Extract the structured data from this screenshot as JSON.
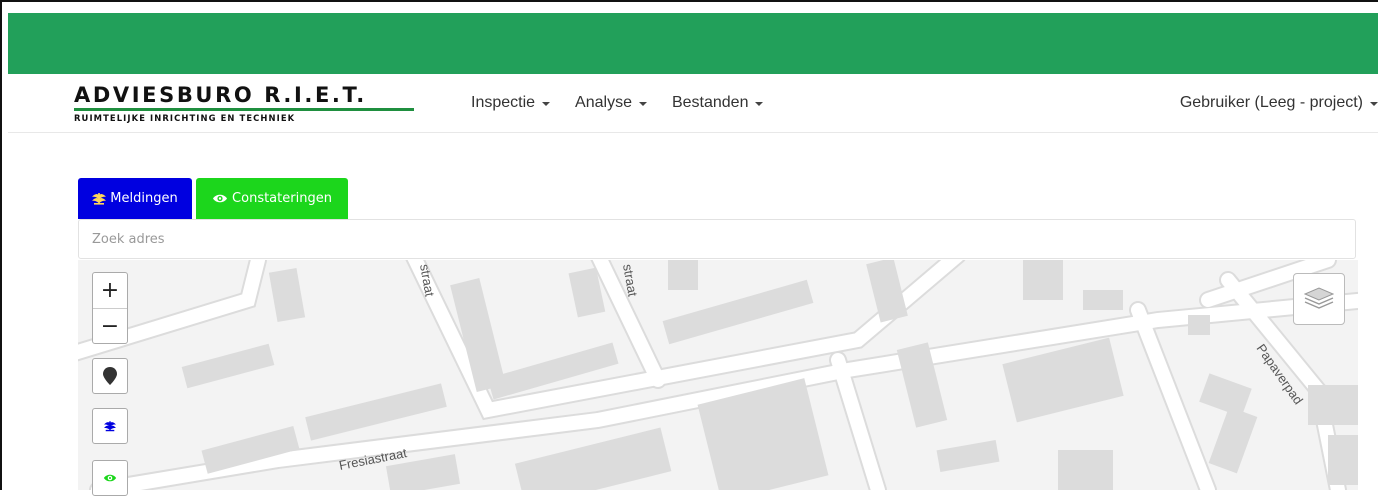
{
  "header": {
    "logo_title": "ADVIESBURO R.I.E.T.",
    "logo_subtitle": "RUIMTELIJKE INRICHTING EN TECHNIEK",
    "menu": [
      {
        "label": "Inspectie"
      },
      {
        "label": "Analyse"
      },
      {
        "label": "Bestanden"
      }
    ],
    "user_label": "Gebruiker (Leeg - project)"
  },
  "toolbar": {
    "meldingen_label": "Meldingen",
    "constateringen_label": "Constateringen"
  },
  "search": {
    "placeholder": "Zoek adres"
  },
  "map": {
    "zoom_in": "+",
    "zoom_out": "−",
    "streets": {
      "s1": "straat",
      "s2": "straat",
      "fresia": "Fresiastraat",
      "papaver": "Papaverpad"
    }
  },
  "colors": {
    "topbar": "#22a05a",
    "meldingen": "#0000e0",
    "constateringen": "#1cd61c",
    "logo_line": "#1f8f3f"
  },
  "icons": {
    "meldingen": "plant-icon",
    "constateringen": "eye-icon",
    "marker": "map-marker-icon",
    "layers": "layers-icon"
  }
}
